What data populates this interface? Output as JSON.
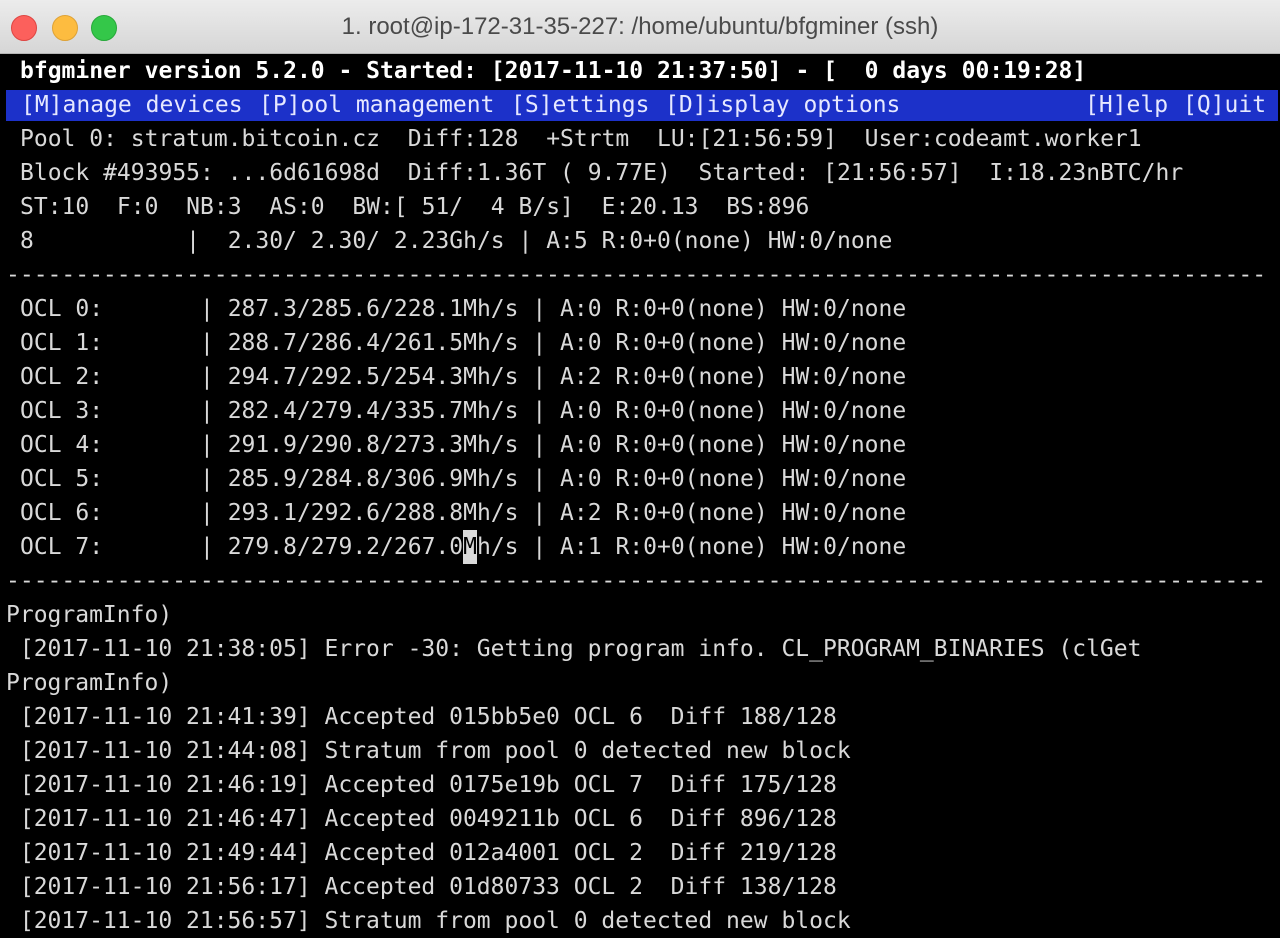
{
  "window": {
    "title": "1. root@ip-172-31-35-227: /home/ubuntu/bfgminer (ssh)"
  },
  "header": "bfgminer version 5.2.0 - Started: [2017-11-10 21:37:50] - [  0 days 00:19:28]",
  "menu": {
    "manage": "[M]anage devices",
    "pool": "[P]ool management",
    "settings": "[S]ettings",
    "display": "[D]isplay options",
    "help": "[H]elp",
    "quit": "[Q]uit"
  },
  "status": {
    "pool_line": "Pool 0: stratum.bitcoin.cz  Diff:128  +Strtm  LU:[21:56:59]  User:codeamt.worker1",
    "block_line": "Block #493955: ...6d61698d  Diff:1.36T ( 9.77E)  Started: [21:56:57]  I:18.23nBTC/hr",
    "stats_line": "ST:10  F:0  NB:3  AS:0  BW:[ 51/  4 B/s]  E:20.13  BS:896",
    "total_line": "8           |  2.30/ 2.30/ 2.23Gh/s | A:5 R:0+0(none) HW:0/none"
  },
  "separator": "-------------------------------------------------------------------------------------------",
  "devices": [
    {
      "name": "OCL 0:",
      "line": "OCL 0:       | 287.3/285.6/228.1Mh/s | A:0 R:0+0(none) HW:0/none"
    },
    {
      "name": "OCL 1:",
      "line": "OCL 1:       | 288.7/286.4/261.5Mh/s | A:0 R:0+0(none) HW:0/none"
    },
    {
      "name": "OCL 2:",
      "line": "OCL 2:       | 294.7/292.5/254.3Mh/s | A:2 R:0+0(none) HW:0/none"
    },
    {
      "name": "OCL 3:",
      "line": "OCL 3:       | 282.4/279.4/335.7Mh/s | A:0 R:0+0(none) HW:0/none"
    },
    {
      "name": "OCL 4:",
      "line": "OCL 4:       | 291.9/290.8/273.3Mh/s | A:0 R:0+0(none) HW:0/none"
    },
    {
      "name": "OCL 5:",
      "line": "OCL 5:       | 285.9/284.8/306.9Mh/s | A:0 R:0+0(none) HW:0/none"
    },
    {
      "name": "OCL 6:",
      "line": "OCL 6:       | 293.1/292.6/288.8Mh/s | A:2 R:0+0(none) HW:0/none"
    }
  ],
  "device_last": {
    "before": "OCL 7:       | 279.8/279.2/267.0",
    "cursor": "M",
    "after": "h/s | A:1 R:0+0(none) HW:0/none"
  },
  "log": [
    "ProgramInfo)",
    " [2017-11-10 21:38:05] Error -30: Getting program info. CL_PROGRAM_BINARIES (clGet",
    "ProgramInfo)",
    " [2017-11-10 21:41:39] Accepted 015bb5e0 OCL 6  Diff 188/128",
    " [2017-11-10 21:44:08] Stratum from pool 0 detected new block",
    " [2017-11-10 21:46:19] Accepted 0175e19b OCL 7  Diff 175/128",
    " [2017-11-10 21:46:47] Accepted 0049211b OCL 6  Diff 896/128",
    " [2017-11-10 21:49:44] Accepted 012a4001 OCL 2  Diff 219/128",
    " [2017-11-10 21:56:17] Accepted 01d80733 OCL 2  Diff 138/128",
    " [2017-11-10 21:56:57] Stratum from pool 0 detected new block"
  ]
}
